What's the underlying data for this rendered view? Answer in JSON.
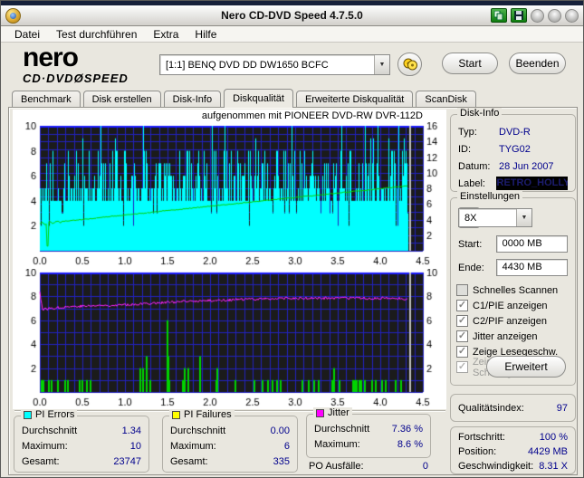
{
  "window": {
    "title": "Nero CD-DVD Speed 4.7.5.0"
  },
  "menu": {
    "items": [
      "Datei",
      "Test durchführen",
      "Extra",
      "Hilfe"
    ]
  },
  "toolbar": {
    "brand_nero": "nero",
    "brand_cddvd": "CD·DVD",
    "brand_disc": "Ø",
    "brand_speed": "SPEED",
    "drive": "[1:1]   BENQ DVD DD DW1650 BCFC",
    "start_label": "Start",
    "quit_label": "Beenden"
  },
  "tabs": {
    "items": [
      "Benchmark",
      "Disk erstellen",
      "Disk-Info",
      "Diskqualität",
      "Erweiterte Diskqualität",
      "ScanDisk"
    ],
    "active": "Diskqualität"
  },
  "disk_info": {
    "title": "Disk-Info",
    "rows": [
      {
        "label": "Typ:",
        "value": "DVD-R"
      },
      {
        "label": "ID:",
        "value": "TYG02"
      },
      {
        "label": "Datum:",
        "value": "28 Jun 2007"
      }
    ],
    "label_label": "Label:",
    "label_value": "RETRO_HOLLY\\"
  },
  "settings": {
    "title": "Einstellungen",
    "speed_value": "8X",
    "start_label": "Start:",
    "start_value": "0000 MB",
    "end_label": "Ende:",
    "end_value": "4430 MB",
    "checkboxes": [
      {
        "label": "Schnelles Scannen",
        "checked": false,
        "enabled": true
      },
      {
        "label": "C1/PIE anzeigen",
        "checked": true,
        "enabled": true
      },
      {
        "label": "C2/PIF anzeigen",
        "checked": true,
        "enabled": true
      },
      {
        "label": "Jitter anzeigen",
        "checked": true,
        "enabled": true
      },
      {
        "label": "Zeige Lesegeschw.",
        "checked": true,
        "enabled": true
      },
      {
        "label": "Zeige Schreibgeschw.",
        "checked": true,
        "enabled": false
      }
    ],
    "advanced_label": "Erweitert"
  },
  "quality": {
    "label": "Qualitätsindex:",
    "value": "97"
  },
  "progress": {
    "rows": [
      {
        "label": "Fortschritt:",
        "value": "100 %"
      },
      {
        "label": "Position:",
        "value": "4429 MB"
      },
      {
        "label": "Geschwindigkeit:",
        "value": "8.31 X"
      }
    ]
  },
  "stats": {
    "pi_errors": {
      "title": "PI Errors",
      "color": "#00ffff",
      "rows": [
        {
          "label": "Durchschnitt",
          "value": "1.34"
        },
        {
          "label": "Maximum:",
          "value": "10"
        },
        {
          "label": "Gesamt:",
          "value": "23747"
        }
      ]
    },
    "pi_failures": {
      "title": "PI Failures",
      "color": "#ffff00",
      "rows": [
        {
          "label": "Durchschnitt",
          "value": "0.00"
        },
        {
          "label": "Maximum:",
          "value": "6"
        },
        {
          "label": "Gesamt:",
          "value": "335"
        }
      ]
    },
    "jitter": {
      "title": "Jitter",
      "color": "#ff00ff",
      "rows": [
        {
          "label": "Durchschnitt",
          "value": "7.36 %"
        },
        {
          "label": "Maximum:",
          "value": "8.6 %"
        }
      ]
    },
    "po_label": "PO Ausfälle:",
    "po_value": "0"
  },
  "chart_data": [
    {
      "type": "area",
      "name": "pi-errors-over-position",
      "title": "aufgenommen mit PIONEER  DVD-RW  DVR-112D",
      "x_range_gb": [
        0,
        4.5
      ],
      "x_ticks": [
        "0.0",
        "0.5",
        "1.0",
        "1.5",
        "2.0",
        "2.5",
        "3.0",
        "3.5",
        "4.0",
        "4.5"
      ],
      "left_axis": {
        "range": [
          0,
          10
        ],
        "ticks": [
          2,
          4,
          6,
          8,
          10
        ]
      },
      "right_axis": {
        "range": [
          0,
          16
        ],
        "ticks": [
          2,
          4,
          6,
          8,
          10,
          12,
          14,
          16
        ]
      },
      "data_end_gb": 4.32,
      "grid_color": "#2222c0",
      "bg_color": "#1b1b1b",
      "pi_errors": {
        "color": "#00ffff",
        "base_level": 4.5,
        "max": 10,
        "average": 1.34,
        "total": 23747,
        "seed": 1234
      },
      "speed_line": {
        "color": "#00d400",
        "start_x": 3.45,
        "end_x": 8.31,
        "dip_at_gb": 0.09,
        "dip_to_x": 0.6
      },
      "cursor_gb": 4.32,
      "cursor_color": "#c0c0c0"
    },
    {
      "type": "line+bars",
      "name": "jitter-and-pi-failures-over-position",
      "x_range_gb": [
        0,
        4.5
      ],
      "x_ticks": [
        "0.0",
        "0.5",
        "1.0",
        "1.5",
        "2.0",
        "2.5",
        "3.0",
        "3.5",
        "4.0",
        "4.5"
      ],
      "left_axis": {
        "range": [
          0,
          10
        ],
        "ticks": [
          2,
          4,
          6,
          8,
          10
        ]
      },
      "right_axis": {
        "range": [
          0,
          10
        ],
        "ticks": [
          2,
          4,
          6,
          8,
          10
        ]
      },
      "data_end_gb": 4.32,
      "grid_color": "#2222c0",
      "bg_color": "#1b1b1b",
      "jitter": {
        "color": "#ff22ff",
        "average_pct": 7.36,
        "max_pct": 8.6,
        "seed": 77,
        "noise": 0.22,
        "anchors": [
          [
            0,
            8.4
          ],
          [
            0.03,
            6.9
          ],
          [
            0.12,
            7.0
          ],
          [
            0.35,
            7.15
          ],
          [
            1.0,
            7.3
          ],
          [
            1.5,
            7.5
          ],
          [
            2.0,
            7.65
          ],
          [
            2.6,
            7.8
          ],
          [
            3.2,
            7.85
          ],
          [
            4.0,
            7.85
          ],
          [
            4.32,
            7.8
          ]
        ]
      },
      "pi_failures": {
        "color": "#00d400",
        "max": 6,
        "total": 335,
        "spikes": [
          [
            0.02,
            1
          ],
          [
            0.045,
            1
          ],
          [
            0.11,
            1
          ],
          [
            0.135,
            1
          ],
          [
            0.21,
            1
          ],
          [
            0.3,
            1
          ],
          [
            0.325,
            1
          ],
          [
            0.47,
            1
          ],
          [
            0.5,
            1
          ],
          [
            0.55,
            1
          ],
          [
            0.6,
            1
          ],
          [
            1.18,
            2
          ],
          [
            1.215,
            2
          ],
          [
            1.25,
            3
          ],
          [
            1.3,
            1
          ],
          [
            1.495,
            1
          ],
          [
            1.5,
            6
          ],
          [
            1.51,
            3
          ],
          [
            1.525,
            1
          ],
          [
            1.68,
            1
          ],
          [
            1.705,
            2
          ],
          [
            1.74,
            2
          ],
          [
            1.88,
            3
          ],
          [
            2.075,
            1
          ],
          [
            2.09,
            2
          ],
          [
            2.3,
            1
          ],
          [
            2.52,
            1
          ],
          [
            2.62,
            1
          ],
          [
            2.68,
            1
          ],
          [
            2.73,
            1
          ],
          [
            2.79,
            1
          ],
          [
            2.83,
            1
          ],
          [
            3.08,
            1
          ],
          [
            3.16,
            1
          ],
          [
            3.22,
            1
          ],
          [
            3.28,
            1
          ],
          [
            3.44,
            1
          ],
          [
            3.455,
            2
          ],
          [
            3.52,
            1
          ],
          [
            3.68,
            1
          ],
          [
            3.7,
            1
          ],
          [
            3.72,
            1
          ],
          [
            3.75,
            1
          ],
          [
            3.78,
            1
          ],
          [
            3.82,
            1
          ],
          [
            3.9,
            1
          ],
          [
            3.95,
            1
          ],
          [
            4.02,
            1
          ],
          [
            4.06,
            1
          ],
          [
            4.18,
            1
          ],
          [
            4.24,
            1
          ]
        ]
      },
      "cursor_gb": 4.32,
      "cursor_color": "#c0c0c0"
    }
  ]
}
